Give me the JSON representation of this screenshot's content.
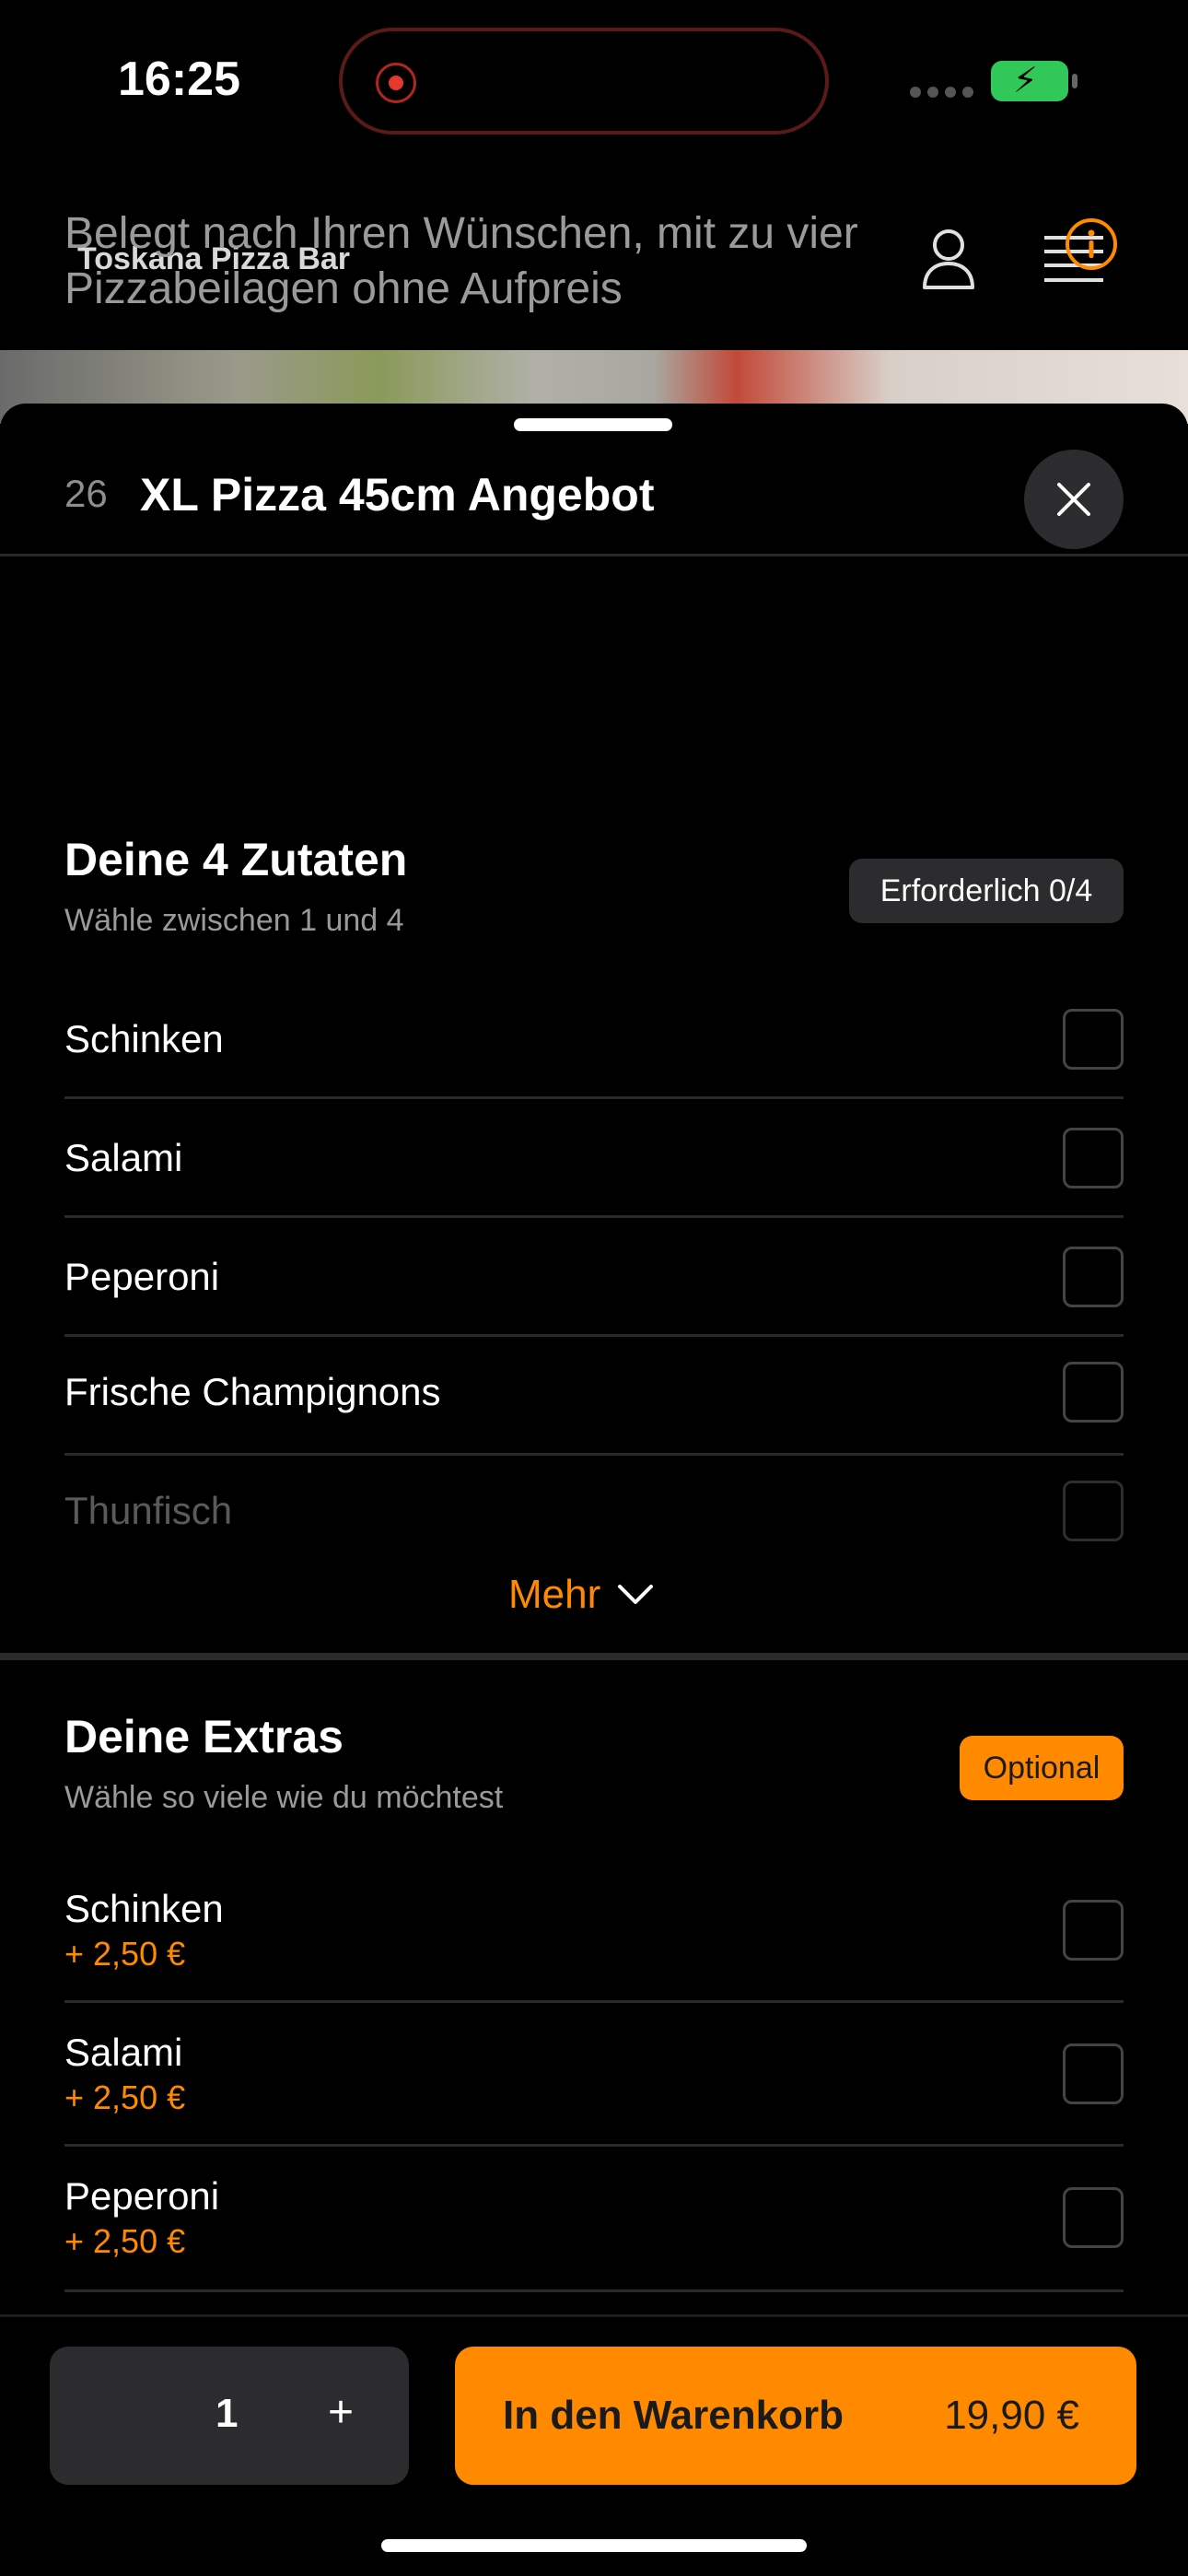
{
  "status_bar": {
    "time": "16:25"
  },
  "header": {
    "brand": "Toskana Pizza Bar"
  },
  "product": {
    "number": "26",
    "title": "XL Pizza 45cm Angebot",
    "description": "Belegt nach Ihren Wünschen, mit zu vier Pizzabeilagen ohne Aufpreis"
  },
  "ingredients": {
    "title": "Deine 4 Zutaten",
    "subtitle": "Wähle zwischen 1 und 4",
    "badge": "Erforderlich 0/4",
    "items": [
      {
        "label": "Schinken",
        "checked": false
      },
      {
        "label": "Salami",
        "checked": false
      },
      {
        "label": "Peperoni",
        "checked": false
      },
      {
        "label": "Frische Champignons",
        "checked": false
      },
      {
        "label": "Thunfisch",
        "checked": false
      }
    ],
    "more_label": "Mehr"
  },
  "extras": {
    "title": "Deine Extras",
    "subtitle": "Wähle so viele wie du möchtest",
    "badge": "Optional",
    "items": [
      {
        "label": "Schinken",
        "price": "+ 2,50 €",
        "checked": false
      },
      {
        "label": "Salami",
        "price": "+ 2,50 €",
        "checked": false
      },
      {
        "label": "Peperoni",
        "price": "+ 2,50 €",
        "checked": false
      }
    ]
  },
  "bottom": {
    "quantity": "1",
    "plus": "+",
    "cart_label": "In den Warenkorb",
    "cart_price": "19,90 €"
  },
  "colors": {
    "accent": "#ff8a00",
    "surface": "#2c2c2e",
    "background": "#000000"
  }
}
